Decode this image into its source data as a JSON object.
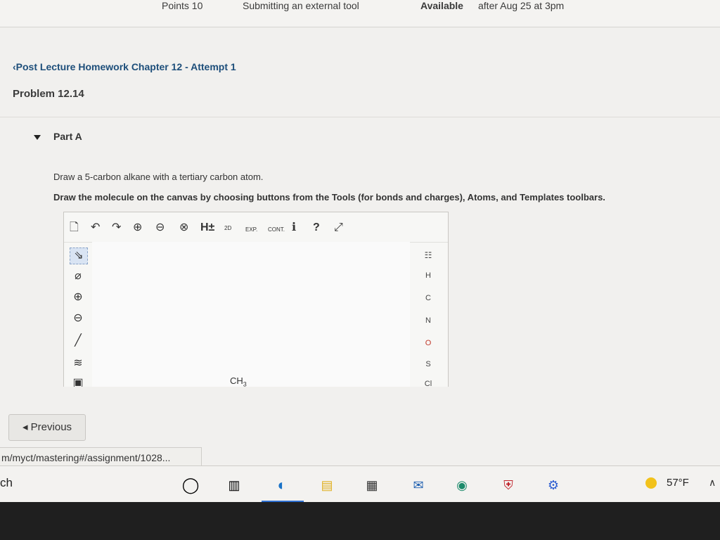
{
  "topbar": {
    "points": "Points 10",
    "submitting": "Submitting an external tool",
    "available_label": "Available",
    "available_value": "after Aug 25 at 3pm"
  },
  "breadcrumb": "Post Lecture Homework Chapter 12 - Attempt 1",
  "problem_title": "Problem 12.14",
  "part_label": "Part A",
  "question": {
    "line1": "Draw a 5-carbon alkane with a tertiary carbon atom.",
    "line2": "Draw the molecule on the canvas by choosing buttons from the Tools (for bonds and charges), Atoms, and Templates toolbars."
  },
  "editor": {
    "toolbar": {
      "h_label": "H±",
      "label_2d": "2D",
      "exp_label": "EXP.",
      "cont_label": "CONT."
    },
    "canvas_text": {
      "ch": "CH",
      "sub": "3"
    },
    "atoms": [
      "H",
      "C",
      "N",
      "O",
      "S",
      "Cl"
    ]
  },
  "previous_label": "Previous",
  "status_url": "m/myct/mastering#/assignment/1028...",
  "taskbar": {
    "search_text": "ch",
    "temperature": "57°F"
  }
}
